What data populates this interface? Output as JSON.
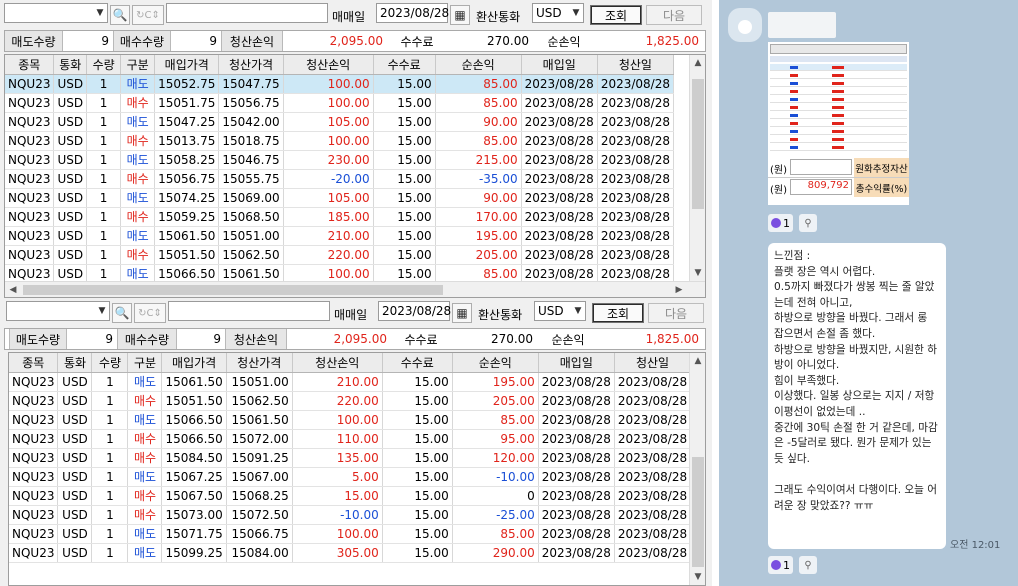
{
  "toolbar": {
    "trade_date_label": "매매일",
    "trade_date": "2023/08/28",
    "currency_label": "환산통화",
    "currency": "USD",
    "query_button": "조회",
    "next_button": "다음"
  },
  "summary": {
    "sell_qty_label": "매도수량",
    "sell_qty": "9",
    "buy_qty_label": "매수수량",
    "buy_qty": "9",
    "pnl_label": "청산손익",
    "pnl": "2,095.00",
    "fee_label": "수수료",
    "fee": "270.00",
    "net_label": "순손익",
    "net": "1,825.00"
  },
  "columns": [
    "종목",
    "통화",
    "수량",
    "구분",
    "매입가격",
    "청산가격",
    "청산손익",
    "수수료",
    "순손익",
    "매입일",
    "청산일"
  ],
  "table_top": [
    [
      "NQU23",
      "USD",
      "1",
      "매도",
      "15052.75",
      "15047.75",
      "100.00",
      "15.00",
      "85.00",
      "2023/08/28",
      "2023/08/28"
    ],
    [
      "NQU23",
      "USD",
      "1",
      "매수",
      "15051.75",
      "15056.75",
      "100.00",
      "15.00",
      "85.00",
      "2023/08/28",
      "2023/08/28"
    ],
    [
      "NQU23",
      "USD",
      "1",
      "매도",
      "15047.25",
      "15042.00",
      "105.00",
      "15.00",
      "90.00",
      "2023/08/28",
      "2023/08/28"
    ],
    [
      "NQU23",
      "USD",
      "1",
      "매수",
      "15013.75",
      "15018.75",
      "100.00",
      "15.00",
      "85.00",
      "2023/08/28",
      "2023/08/28"
    ],
    [
      "NQU23",
      "USD",
      "1",
      "매도",
      "15058.25",
      "15046.75",
      "230.00",
      "15.00",
      "215.00",
      "2023/08/28",
      "2023/08/28"
    ],
    [
      "NQU23",
      "USD",
      "1",
      "매수",
      "15056.75",
      "15055.75",
      "-20.00",
      "15.00",
      "-35.00",
      "2023/08/28",
      "2023/08/28"
    ],
    [
      "NQU23",
      "USD",
      "1",
      "매도",
      "15074.25",
      "15069.00",
      "105.00",
      "15.00",
      "90.00",
      "2023/08/28",
      "2023/08/28"
    ],
    [
      "NQU23",
      "USD",
      "1",
      "매수",
      "15059.25",
      "15068.50",
      "185.00",
      "15.00",
      "170.00",
      "2023/08/28",
      "2023/08/28"
    ],
    [
      "NQU23",
      "USD",
      "1",
      "매도",
      "15061.50",
      "15051.00",
      "210.00",
      "15.00",
      "195.00",
      "2023/08/28",
      "2023/08/28"
    ],
    [
      "NQU23",
      "USD",
      "1",
      "매수",
      "15051.50",
      "15062.50",
      "220.00",
      "15.00",
      "205.00",
      "2023/08/28",
      "2023/08/28"
    ],
    [
      "NQU23",
      "USD",
      "1",
      "매도",
      "15066.50",
      "15061.50",
      "100.00",
      "15.00",
      "85.00",
      "2023/08/28",
      "2023/08/28"
    ]
  ],
  "table_bottom": [
    [
      "NQU23",
      "USD",
      "1",
      "매도",
      "15061.50",
      "15051.00",
      "210.00",
      "15.00",
      "195.00",
      "2023/08/28",
      "2023/08/28"
    ],
    [
      "NQU23",
      "USD",
      "1",
      "매수",
      "15051.50",
      "15062.50",
      "220.00",
      "15.00",
      "205.00",
      "2023/08/28",
      "2023/08/28"
    ],
    [
      "NQU23",
      "USD",
      "1",
      "매도",
      "15066.50",
      "15061.50",
      "100.00",
      "15.00",
      "85.00",
      "2023/08/28",
      "2023/08/28"
    ],
    [
      "NQU23",
      "USD",
      "1",
      "매수",
      "15066.50",
      "15072.00",
      "110.00",
      "15.00",
      "95.00",
      "2023/08/28",
      "2023/08/28"
    ],
    [
      "NQU23",
      "USD",
      "1",
      "매수",
      "15084.50",
      "15091.25",
      "135.00",
      "15.00",
      "120.00",
      "2023/08/28",
      "2023/08/28"
    ],
    [
      "NQU23",
      "USD",
      "1",
      "매도",
      "15067.25",
      "15067.00",
      "5.00",
      "15.00",
      "-10.00",
      "2023/08/28",
      "2023/08/28"
    ],
    [
      "NQU23",
      "USD",
      "1",
      "매수",
      "15067.50",
      "15068.25",
      "15.00",
      "15.00",
      "0",
      "2023/08/28",
      "2023/08/28"
    ],
    [
      "NQU23",
      "USD",
      "1",
      "매수",
      "15073.00",
      "15072.50",
      "-10.00",
      "15.00",
      "-25.00",
      "2023/08/28",
      "2023/08/28"
    ],
    [
      "NQU23",
      "USD",
      "1",
      "매도",
      "15071.75",
      "15066.75",
      "100.00",
      "15.00",
      "85.00",
      "2023/08/28",
      "2023/08/28"
    ],
    [
      "NQU23",
      "USD",
      "1",
      "매도",
      "15099.25",
      "15084.00",
      "305.00",
      "15.00",
      "290.00",
      "2023/08/28",
      "2023/08/28"
    ]
  ],
  "chat": {
    "thumb_row1_label": "(원)",
    "thumb_row1_right": "원화추정자산",
    "thumb_row2_label": "(원)",
    "thumb_row2_value": "809,792",
    "thumb_row2_right": "총수익률(%)",
    "reaction_count": "1",
    "message": "느낀점 :\n플랫 장은 역시 어렵다.\n0.5까지 빠졌다가 쌍봉 찍는 줄 알았는데 전혀 아니고,\n하방으로 방향을 바꿨다. 그래서 롱 잡으면서 손절 좀 했다.\n하방으로 방향을 바꿨지만, 시원한 하방이 아니었다.\n힘이 부족했다.\n이상했다. 일봉 상으로는 지지 / 저항 이평선이 없었는데 ..\n중간에 30틱 손절 한 거 같은데, 마감은 -5달러로 됐다. 뭔가 문제가 있는 듯 싶다.\n\n그래도 수익이여서 다행이다. 오늘 어려운 장 맞았죠?? ㅠㅠ",
    "time": "오전 12:01"
  },
  "colors": {
    "positive": "#e0241b",
    "negative": "#1a4fd6",
    "selected_row": "#cde8f6",
    "chat_bg": "#b2c7d9"
  }
}
